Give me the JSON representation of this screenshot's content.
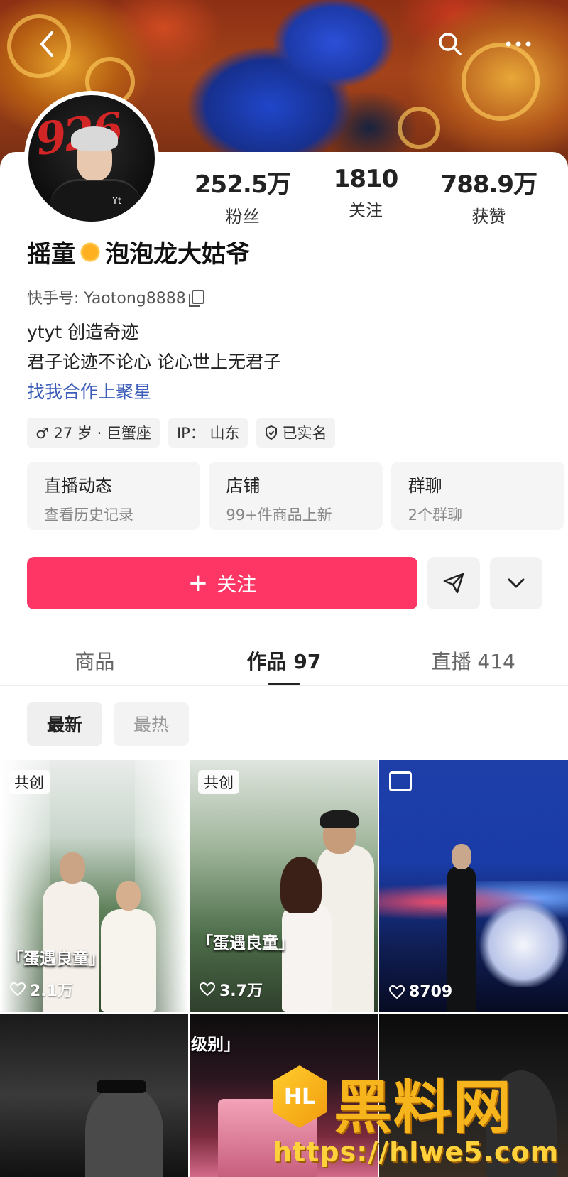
{
  "header": {
    "back_icon": "back-icon",
    "search_icon": "search-icon",
    "more_icon": "more-icon"
  },
  "profile": {
    "avatar_text": "926",
    "avatar_badge": "Yt",
    "name_part1": "摇童",
    "name_part2": "泡泡龙大姑爷",
    "id_label": "快手号: Yaotong8888",
    "bio_line1": "ytyt   创造奇迹",
    "bio_line2": "君子论迹不论心  论心世上无君子",
    "bio_link": "找我合作上聚星"
  },
  "stats": [
    {
      "value": "252.5万",
      "label": "粉丝"
    },
    {
      "value": "1810",
      "label": "关注"
    },
    {
      "value": "788.9万",
      "label": "获赞"
    }
  ],
  "tags": [
    {
      "icon": "male-icon",
      "text": "♂ 27 岁 · 巨蟹座"
    },
    {
      "icon": "",
      "text": "IP： 山东"
    },
    {
      "icon": "verified-icon",
      "text": "已实名"
    }
  ],
  "entries": [
    {
      "title": "直播动态",
      "sub": "查看历史记录"
    },
    {
      "title": "店铺",
      "sub": "99+件商品上新"
    },
    {
      "title": "群聊",
      "sub": "2个群聊"
    }
  ],
  "actions": {
    "follow_label": "关注",
    "plus": "+"
  },
  "tabs": [
    {
      "label": "商品"
    },
    {
      "label": "作品 97"
    },
    {
      "label": "直播 414"
    }
  ],
  "sort": [
    "最新",
    "最热"
  ],
  "grid": [
    {
      "badge": "共创",
      "caption": "「蛋遇良童」",
      "likes": "2.1万"
    },
    {
      "badge": "共创",
      "caption": "「蛋遇良童」",
      "likes": "3.7万"
    },
    {
      "badge": "",
      "caption": "",
      "likes": "8709"
    },
    {
      "badge": "",
      "caption": "",
      "likes": ""
    },
    {
      "badge": "",
      "caption": "级别」",
      "likes": ""
    },
    {
      "badge": "",
      "caption": "",
      "likes": ""
    }
  ],
  "watermark": {
    "logo": "HL",
    "title": "黑料网",
    "url": "https://hlwe5.com"
  },
  "colors": {
    "accent": "#fe3666",
    "link": "#3b5cb8"
  }
}
